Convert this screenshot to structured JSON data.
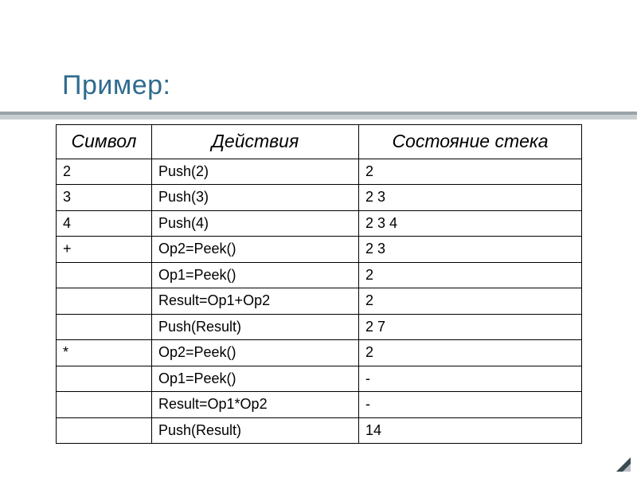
{
  "title": "Пример:",
  "headers": [
    "Символ",
    "Действия",
    "Состояние стека"
  ],
  "rows": [
    {
      "symbol": "2",
      "action": "Push(2)",
      "stack": "2"
    },
    {
      "symbol": "3",
      "action": "Push(3)",
      "stack": "2 3"
    },
    {
      "symbol": "4",
      "action": "Push(4)",
      "stack": "2 3 4"
    },
    {
      "symbol": "+",
      "action": "Op2=Peek()",
      "stack": "2 3"
    },
    {
      "symbol": "",
      "action": "Op1=Peek()",
      "stack": "2"
    },
    {
      "symbol": "",
      "action": "Result=Op1+Op2",
      "stack": "2"
    },
    {
      "symbol": "",
      "action": "Push(Result)",
      "stack": "2 7"
    },
    {
      "symbol": "*",
      "action": "Op2=Peek()",
      "stack": "2"
    },
    {
      "symbol": "",
      "action": "Op1=Peek()",
      "stack": "-"
    },
    {
      "symbol": "",
      "action": "Result=Op1*Op2",
      "stack": "-"
    },
    {
      "symbol": "",
      "action": "Push(Result)",
      "stack": "14"
    }
  ],
  "chart_data": {
    "type": "table",
    "title": "Пример:",
    "columns": [
      "Символ",
      "Действия",
      "Состояние стека"
    ],
    "data": [
      [
        "2",
        "Push(2)",
        "2"
      ],
      [
        "3",
        "Push(3)",
        "2 3"
      ],
      [
        "4",
        "Push(4)",
        "2 3 4"
      ],
      [
        "+",
        "Op2=Peek()",
        "2 3"
      ],
      [
        "",
        "Op1=Peek()",
        "2"
      ],
      [
        "",
        "Result=Op1+Op2",
        "2"
      ],
      [
        "",
        "Push(Result)",
        "2 7"
      ],
      [
        "*",
        "Op2=Peek()",
        "2"
      ],
      [
        "",
        "Op1=Peek()",
        "-"
      ],
      [
        "",
        "Result=Op1*Op2",
        "-"
      ],
      [
        "",
        "Push(Result)",
        "14"
      ]
    ]
  }
}
